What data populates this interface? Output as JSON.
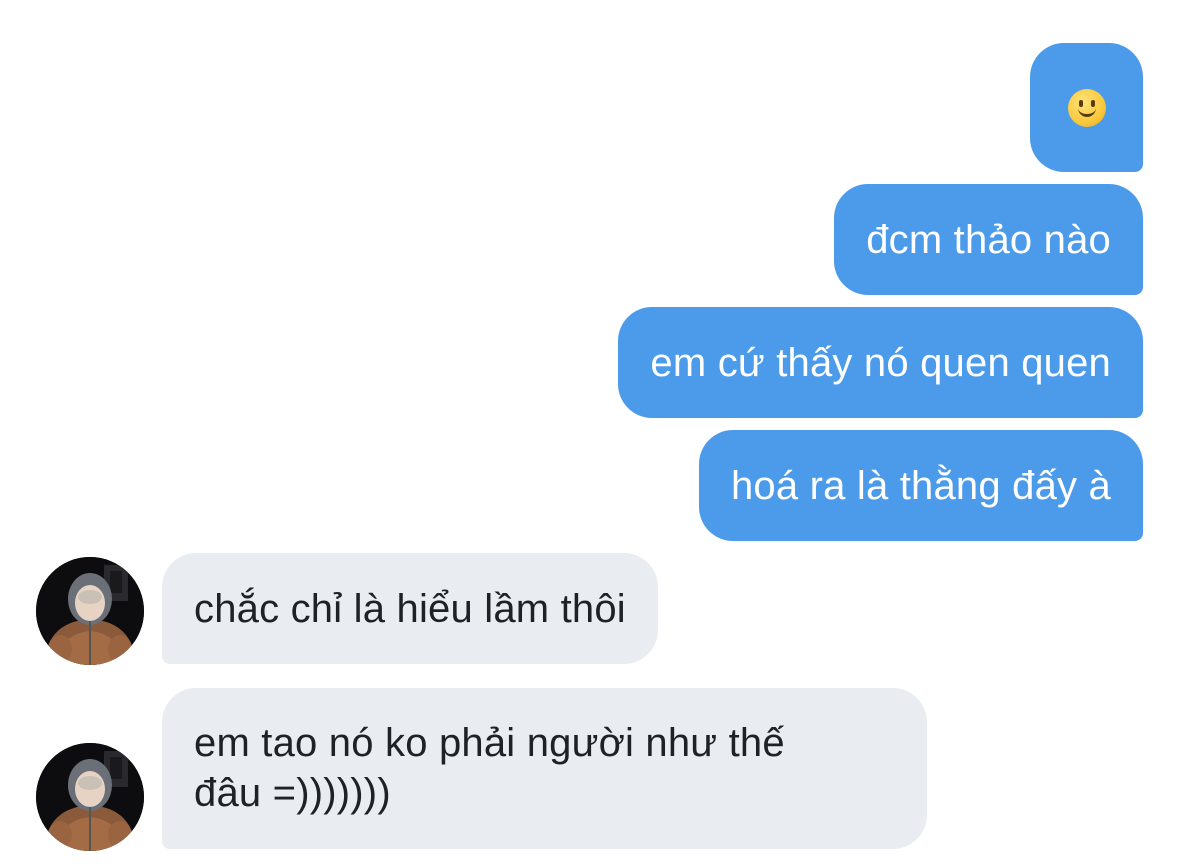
{
  "messages": {
    "outgoing": [
      {
        "type": "emoji",
        "icon": "slightly-smiling-face-icon"
      },
      {
        "text": "đcm thảo nào"
      },
      {
        "text": "em cứ thấy nó quen quen"
      },
      {
        "text": "hoá ra là thằng đấy à"
      }
    ],
    "incoming": [
      {
        "text": "chắc chỉ là hiểu lầm thôi"
      },
      {
        "lines": [
          "em tao nó ko phải người như thế",
          "đâu =)))))))"
        ]
      }
    ]
  },
  "colors": {
    "outgoing_bubble": "#4c9bea",
    "incoming_bubble": "#e9ecf0",
    "outgoing_text": "#ffffff",
    "incoming_text": "#1d2226"
  }
}
